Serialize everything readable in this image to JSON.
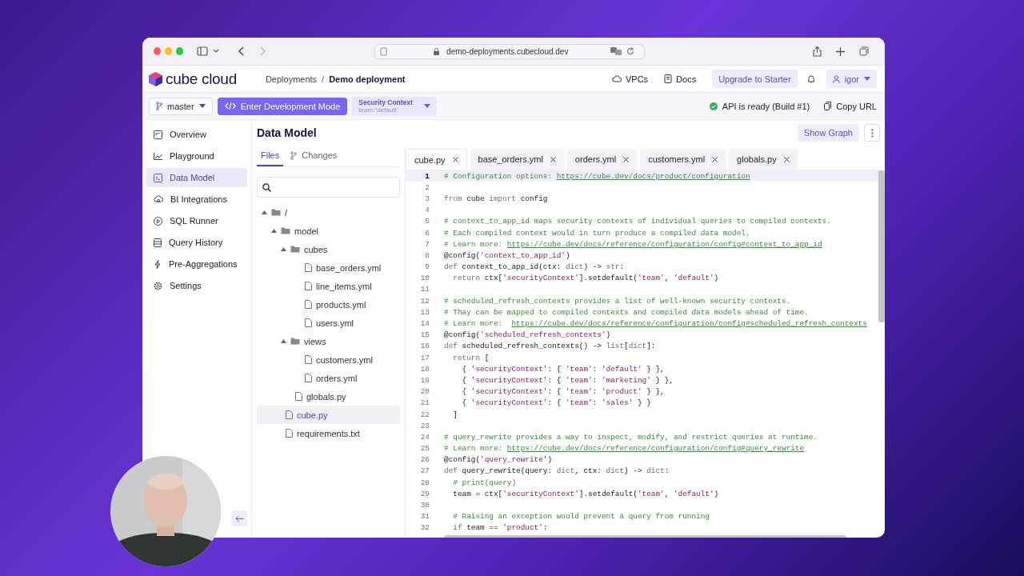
{
  "browser": {
    "url": "demo-deployments.cubecloud.dev"
  },
  "header": {
    "logo": "cube cloud",
    "breadcrumbs": [
      "Deployments",
      "Demo deployment"
    ],
    "breadcrumb_separator": "/",
    "links": [
      "VPCs",
      "Docs"
    ],
    "upgrade_button": "Upgrade to Starter",
    "user": "igor"
  },
  "toolbar": {
    "branch": "master",
    "dev_mode_button": "Enter Development Mode",
    "security_context": {
      "label": "Security Context",
      "value": "team:\"default\""
    },
    "status": "API is ready (Build #1)",
    "copy_button": "Copy URL"
  },
  "sidebar": {
    "items": [
      {
        "label": "Overview",
        "selected": false
      },
      {
        "label": "Playground",
        "selected": false
      },
      {
        "label": "Data Model",
        "selected": true
      },
      {
        "label": "BI Integrations",
        "selected": false
      },
      {
        "label": "SQL Runner",
        "selected": false
      },
      {
        "label": "Query History",
        "selected": false
      },
      {
        "label": "Pre-Aggregations",
        "selected": false
      },
      {
        "label": "Settings",
        "selected": false
      }
    ]
  },
  "page": {
    "title": "Data Model",
    "show_graph_button": "Show Graph"
  },
  "file_panel": {
    "tabs": [
      {
        "label": "Files",
        "selected": true
      },
      {
        "label": "Changes",
        "selected": false
      }
    ],
    "tree": [
      {
        "label": "/",
        "kind": "folder",
        "expanded": true,
        "selected": false,
        "children": [
          {
            "label": "model",
            "kind": "folder",
            "expanded": true,
            "selected": false,
            "children": [
              {
                "label": "cubes",
                "kind": "folder",
                "expanded": true,
                "selected": false,
                "children": [
                  {
                    "label": "base_orders.yml",
                    "kind": "file",
                    "selected": false
                  },
                  {
                    "label": "line_items.yml",
                    "kind": "file",
                    "selected": false
                  },
                  {
                    "label": "products.yml",
                    "kind": "file",
                    "selected": false
                  },
                  {
                    "label": "users.yml",
                    "kind": "file",
                    "selected": false
                  }
                ]
              },
              {
                "label": "views",
                "kind": "folder",
                "expanded": true,
                "selected": false,
                "children": [
                  {
                    "label": "customers.yml",
                    "kind": "file",
                    "selected": false
                  },
                  {
                    "label": "orders.yml",
                    "kind": "file",
                    "selected": false
                  }
                ]
              },
              {
                "label": "globals.py",
                "kind": "file",
                "selected": false
              }
            ]
          },
          {
            "label": "cube.py",
            "kind": "file",
            "selected": true
          },
          {
            "label": "requirements.txt",
            "kind": "file",
            "selected": false
          }
        ]
      }
    ]
  },
  "editor": {
    "tabs": [
      {
        "label": "cube.py",
        "selected": true
      },
      {
        "label": "base_orders.yml",
        "selected": false
      },
      {
        "label": "orders.yml",
        "selected": false
      },
      {
        "label": "customers.yml",
        "selected": false
      },
      {
        "label": "globals.py",
        "selected": false
      }
    ],
    "lines": [
      {
        "number": "1",
        "current": true,
        "segments": [
          {
            "kind": "comment",
            "text": "# Configuration options: "
          },
          {
            "kind": "link",
            "text": "https://cube.dev/docs/product/configuration"
          }
        ]
      },
      {
        "number": "2",
        "current": false
      },
      {
        "number": "3",
        "current": false,
        "segments": [
          {
            "kind": "keyword",
            "text": "from"
          },
          {
            "kind": "plain",
            "text": " cube "
          },
          {
            "kind": "keyword",
            "text": "import"
          },
          {
            "kind": "plain",
            "text": " config"
          }
        ]
      },
      {
        "number": "4",
        "current": false
      },
      {
        "number": "5",
        "current": false,
        "segments": [
          {
            "kind": "comment",
            "text": "# context_to_app_id maps security contexts of individual queries to compiled contexts."
          }
        ]
      },
      {
        "number": "6",
        "current": false,
        "segments": [
          {
            "kind": "comment",
            "text": "# Each compiled context would in turn produce a compiled data model."
          }
        ]
      },
      {
        "number": "7",
        "current": false,
        "segments": [
          {
            "kind": "comment",
            "text": "# Learn more: "
          },
          {
            "kind": "link",
            "text": "https://cube.dev/docs/reference/configuration/config#context_to_app_id"
          }
        ]
      },
      {
        "number": "8",
        "current": false,
        "segments": [
          {
            "kind": "plain",
            "text": "@config("
          },
          {
            "kind": "string",
            "text": "'context_to_app_id'"
          },
          {
            "kind": "plain",
            "text": ")"
          }
        ]
      },
      {
        "number": "9",
        "current": false,
        "segments": [
          {
            "kind": "keyword",
            "text": "def"
          },
          {
            "kind": "plain",
            "text": " context_to_app_id(ctx: "
          },
          {
            "kind": "type",
            "text": "dict"
          },
          {
            "kind": "plain",
            "text": ") -> "
          },
          {
            "kind": "type",
            "text": "str"
          },
          {
            "kind": "plain",
            "text": ":"
          }
        ]
      },
      {
        "number": "10",
        "current": false,
        "segments": [
          {
            "kind": "keyword",
            "text": "  return"
          },
          {
            "kind": "plain",
            "text": " ctx["
          },
          {
            "kind": "string",
            "text": "'securityContext'"
          },
          {
            "kind": "plain",
            "text": "].setdefault("
          },
          {
            "kind": "string",
            "text": "'team'"
          },
          {
            "kind": "plain",
            "text": ", "
          },
          {
            "kind": "string",
            "text": "'default'"
          },
          {
            "kind": "plain",
            "text": ")"
          }
        ]
      },
      {
        "number": "11",
        "current": false
      },
      {
        "number": "12",
        "current": false,
        "segments": [
          {
            "kind": "comment",
            "text": "# scheduled_refresh_contexts provides a list of well-known security contexts."
          }
        ]
      },
      {
        "number": "13",
        "current": false,
        "segments": [
          {
            "kind": "comment",
            "text": "# Thay can be mapped to compiled contexts and compiled data models ahead of time."
          }
        ]
      },
      {
        "number": "14",
        "current": false,
        "segments": [
          {
            "kind": "comment",
            "text": "# Learn more:  "
          },
          {
            "kind": "link",
            "text": "https://cube.dev/docs/reference/configuration/config#scheduled_refresh_contexts"
          }
        ]
      },
      {
        "number": "15",
        "current": false,
        "segments": [
          {
            "kind": "plain",
            "text": "@config("
          },
          {
            "kind": "string",
            "text": "'scheduled_refresh_contexts'"
          },
          {
            "kind": "plain",
            "text": ")"
          }
        ]
      },
      {
        "number": "16",
        "current": false,
        "segments": [
          {
            "kind": "keyword",
            "text": "def"
          },
          {
            "kind": "plain",
            "text": " scheduled_refresh_contexts() -> "
          },
          {
            "kind": "type",
            "text": "list"
          },
          {
            "kind": "plain",
            "text": "["
          },
          {
            "kind": "type",
            "text": "dict"
          },
          {
            "kind": "plain",
            "text": "]:"
          }
        ]
      },
      {
        "number": "17",
        "current": false,
        "segments": [
          {
            "kind": "keyword",
            "text": "  return"
          },
          {
            "kind": "plain",
            "text": " ["
          }
        ]
      },
      {
        "number": "18",
        "current": false,
        "segments": [
          {
            "kind": "plain",
            "text": "    { "
          },
          {
            "kind": "string",
            "text": "'securityContext'"
          },
          {
            "kind": "plain",
            "text": ": { "
          },
          {
            "kind": "string",
            "text": "'team'"
          },
          {
            "kind": "plain",
            "text": ": "
          },
          {
            "kind": "string",
            "text": "'default'"
          },
          {
            "kind": "plain",
            "text": " } },"
          }
        ]
      },
      {
        "number": "19",
        "current": false,
        "segments": [
          {
            "kind": "plain",
            "text": "    { "
          },
          {
            "kind": "string",
            "text": "'securityContext'"
          },
          {
            "kind": "plain",
            "text": ": { "
          },
          {
            "kind": "string",
            "text": "'team'"
          },
          {
            "kind": "plain",
            "text": ": "
          },
          {
            "kind": "string",
            "text": "'marketing'"
          },
          {
            "kind": "plain",
            "text": " } },"
          }
        ]
      },
      {
        "number": "20",
        "current": false,
        "segments": [
          {
            "kind": "plain",
            "text": "    { "
          },
          {
            "kind": "string",
            "text": "'securityContext'"
          },
          {
            "kind": "plain",
            "text": ": { "
          },
          {
            "kind": "string",
            "text": "'team'"
          },
          {
            "kind": "plain",
            "text": ": "
          },
          {
            "kind": "string",
            "text": "'product'"
          },
          {
            "kind": "plain",
            "text": " } },"
          }
        ]
      },
      {
        "number": "21",
        "current": false,
        "segments": [
          {
            "kind": "plain",
            "text": "    { "
          },
          {
            "kind": "string",
            "text": "'securityContext'"
          },
          {
            "kind": "plain",
            "text": ": { "
          },
          {
            "kind": "string",
            "text": "'team'"
          },
          {
            "kind": "plain",
            "text": ": "
          },
          {
            "kind": "string",
            "text": "'sales'"
          },
          {
            "kind": "plain",
            "text": " } }"
          }
        ]
      },
      {
        "number": "22",
        "current": false,
        "segments": [
          {
            "kind": "plain",
            "text": "  ]"
          }
        ]
      },
      {
        "number": "23",
        "current": false
      },
      {
        "number": "24",
        "current": false,
        "segments": [
          {
            "kind": "comment",
            "text": "# query_rewrite provides a way to inspect, modify, and restrict queries at runtime."
          }
        ]
      },
      {
        "number": "25",
        "current": false,
        "segments": [
          {
            "kind": "comment",
            "text": "# Learn more: "
          },
          {
            "kind": "link",
            "text": "https://cube.dev/docs/reference/configuration/config#query_rewrite"
          }
        ]
      },
      {
        "number": "26",
        "current": false,
        "segments": [
          {
            "kind": "plain",
            "text": "@config("
          },
          {
            "kind": "string",
            "text": "'query_rewrite'"
          },
          {
            "kind": "plain",
            "text": ")"
          }
        ]
      },
      {
        "number": "27",
        "current": false,
        "segments": [
          {
            "kind": "keyword",
            "text": "def"
          },
          {
            "kind": "plain",
            "text": " query_rewrite(query: "
          },
          {
            "kind": "type",
            "text": "dict"
          },
          {
            "kind": "plain",
            "text": ", ctx: "
          },
          {
            "kind": "type",
            "text": "dict"
          },
          {
            "kind": "plain",
            "text": ") -> "
          },
          {
            "kind": "type",
            "text": "dict"
          },
          {
            "kind": "plain",
            "text": ":"
          }
        ]
      },
      {
        "number": "28",
        "current": false,
        "segments": [
          {
            "kind": "comment",
            "text": "  # print(query)"
          }
        ]
      },
      {
        "number": "29",
        "current": false,
        "segments": [
          {
            "kind": "plain",
            "text": "  team = ctx["
          },
          {
            "kind": "string",
            "text": "'securityContext'"
          },
          {
            "kind": "plain",
            "text": "].setdefault("
          },
          {
            "kind": "string",
            "text": "'team'"
          },
          {
            "kind": "plain",
            "text": ", "
          },
          {
            "kind": "string",
            "text": "'default'"
          },
          {
            "kind": "plain",
            "text": ")"
          }
        ]
      },
      {
        "number": "30",
        "current": false
      },
      {
        "number": "31",
        "current": false,
        "segments": [
          {
            "kind": "comment",
            "text": "  # Raising an exception would prevent a query from running"
          }
        ]
      },
      {
        "number": "32",
        "current": false,
        "segments": [
          {
            "kind": "keyword",
            "text": "  if"
          },
          {
            "kind": "plain",
            "text": " team == "
          },
          {
            "kind": "string",
            "text": "'product'"
          },
          {
            "kind": "plain",
            "text": ":"
          }
        ]
      }
    ]
  }
}
